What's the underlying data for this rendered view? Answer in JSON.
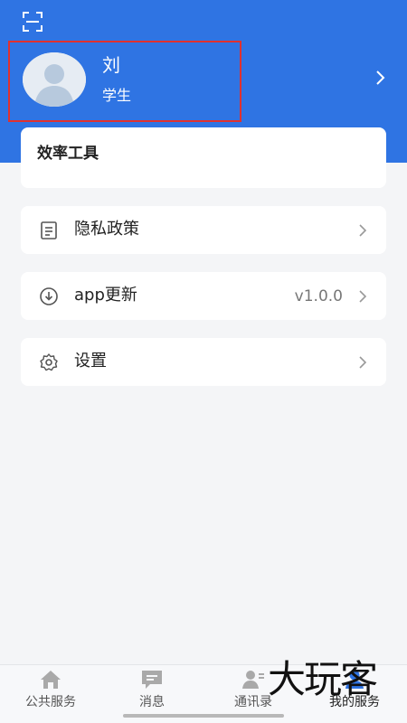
{
  "header": {
    "scan_icon": "scan-icon",
    "user": {
      "name": "刘",
      "role": "学生"
    },
    "arrow_icon": "chevron-right-icon"
  },
  "tools_card": {
    "title": "效率工具"
  },
  "menu": [
    {
      "icon": "document-icon",
      "label": "隐私政策",
      "value": ""
    },
    {
      "icon": "download-icon",
      "label": "app更新",
      "value": "v1.0.0"
    },
    {
      "icon": "gear-icon",
      "label": "设置",
      "value": ""
    }
  ],
  "tabbar": {
    "items": [
      {
        "icon": "home-icon",
        "label": "公共服务"
      },
      {
        "icon": "message-icon",
        "label": "消息"
      },
      {
        "icon": "contacts-icon",
        "label": "通讯录"
      },
      {
        "icon": "user-icon",
        "label": "我的服务",
        "active": true
      }
    ]
  },
  "watermark": {
    "text": "大玩客"
  },
  "colors": {
    "header_bg": "#2f74e3",
    "highlight_border": "#e0312f",
    "page_bg": "#f4f5f7"
  }
}
